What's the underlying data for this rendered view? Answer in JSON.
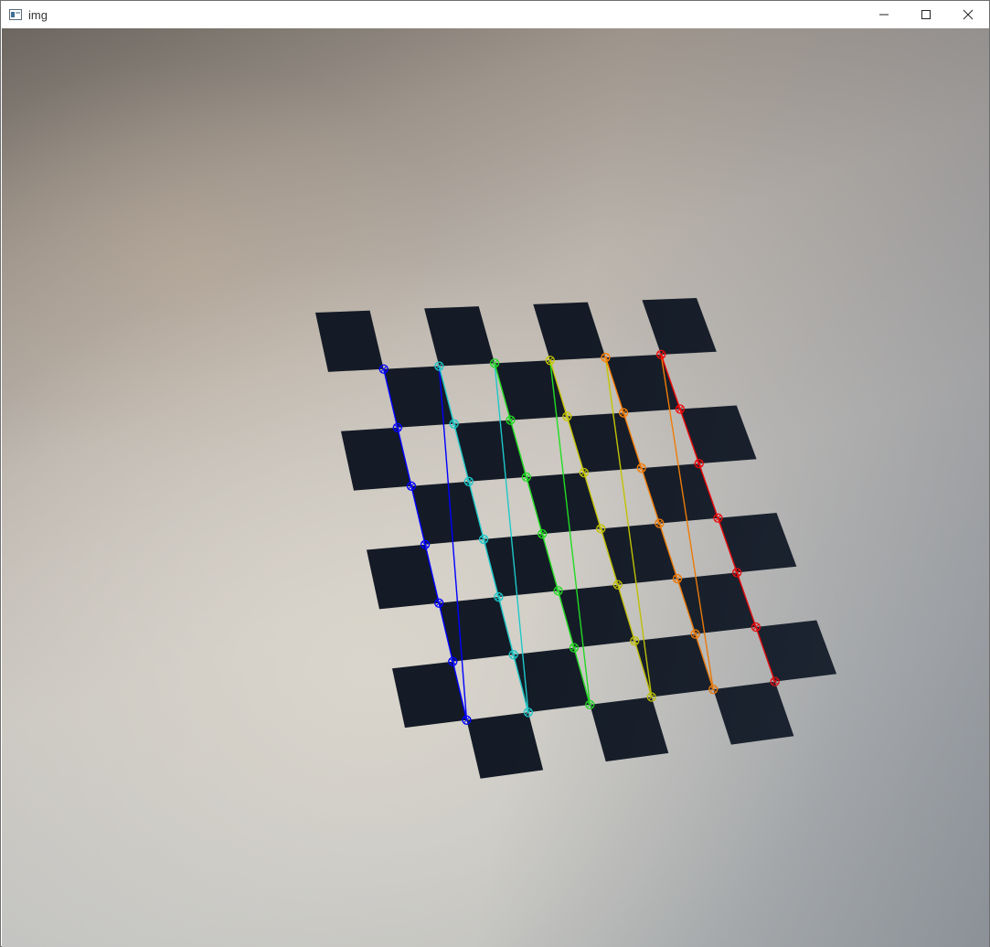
{
  "window": {
    "title": "img",
    "app_icon": "window-app-icon",
    "controls": {
      "minimize": "minimize-icon",
      "maximize": "maximize-icon",
      "close": "close-icon"
    }
  },
  "image": {
    "description_colors": {
      "board_square": "#141b26",
      "background": "#c4c0ba"
    },
    "corner_colors": [
      "#0000ff",
      "#1ec8c8",
      "#22dd22",
      "#c8c800",
      "#ff8000",
      "#ff0000"
    ]
  }
}
